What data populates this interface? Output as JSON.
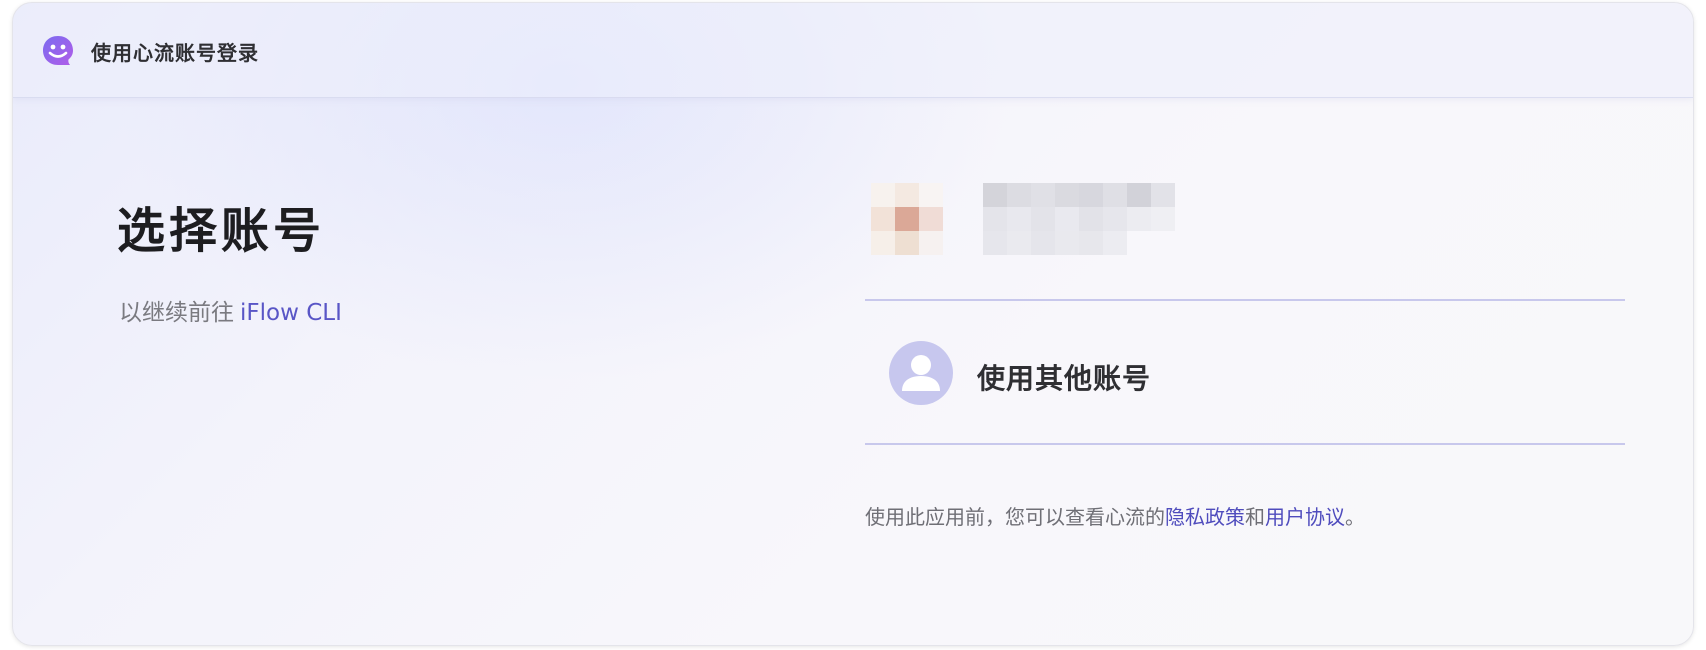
{
  "header": {
    "title": "使用心流账号登录",
    "logo_icon": "iflow-logo-icon"
  },
  "intro": {
    "title": "选择账号",
    "subtitle_prefix": "以继续前往",
    "app_name": "iFlow CLI"
  },
  "accounts": {
    "existing": {
      "note": "redacted-pixelated-account"
    },
    "other": {
      "label": "使用其他账号",
      "icon": "user-icon"
    }
  },
  "policy": {
    "prefix": "使用此应用前，您可以查看心流的",
    "privacy_link": "隐私政策",
    "connector": "和",
    "terms_link": "用户协议",
    "suffix": "。"
  },
  "colors": {
    "accent": "#5956c6",
    "link": "#4f4cbd",
    "divider": "#c8c8ec",
    "avatar_bg": "#c7c7ee"
  }
}
